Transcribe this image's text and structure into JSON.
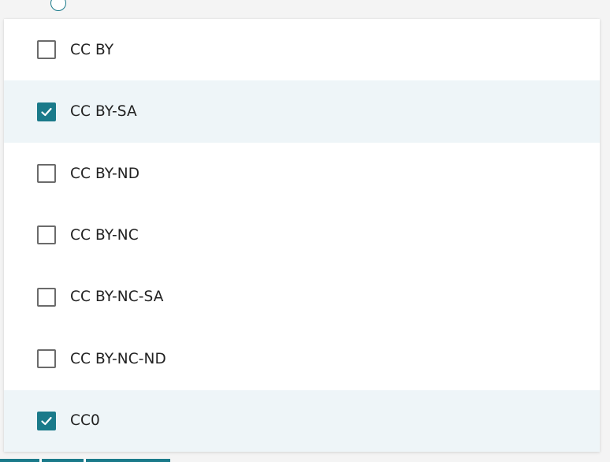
{
  "dropdown": {
    "options": [
      {
        "label": "CC BY",
        "checked": false
      },
      {
        "label": "CC BY-SA",
        "checked": true
      },
      {
        "label": "CC BY-ND",
        "checked": false
      },
      {
        "label": "CC BY-NC",
        "checked": false
      },
      {
        "label": "CC BY-NC-SA",
        "checked": false
      },
      {
        "label": "CC BY-NC-ND",
        "checked": false
      },
      {
        "label": "CC0",
        "checked": true
      }
    ]
  },
  "icons": {
    "checkbox_checked": "check-icon",
    "info": "info-icon"
  },
  "colors": {
    "accent": "#1a7a8a",
    "selected_row_bg": "#eef5f8",
    "checkbox_border": "#6b6b6b",
    "text": "#222222"
  }
}
